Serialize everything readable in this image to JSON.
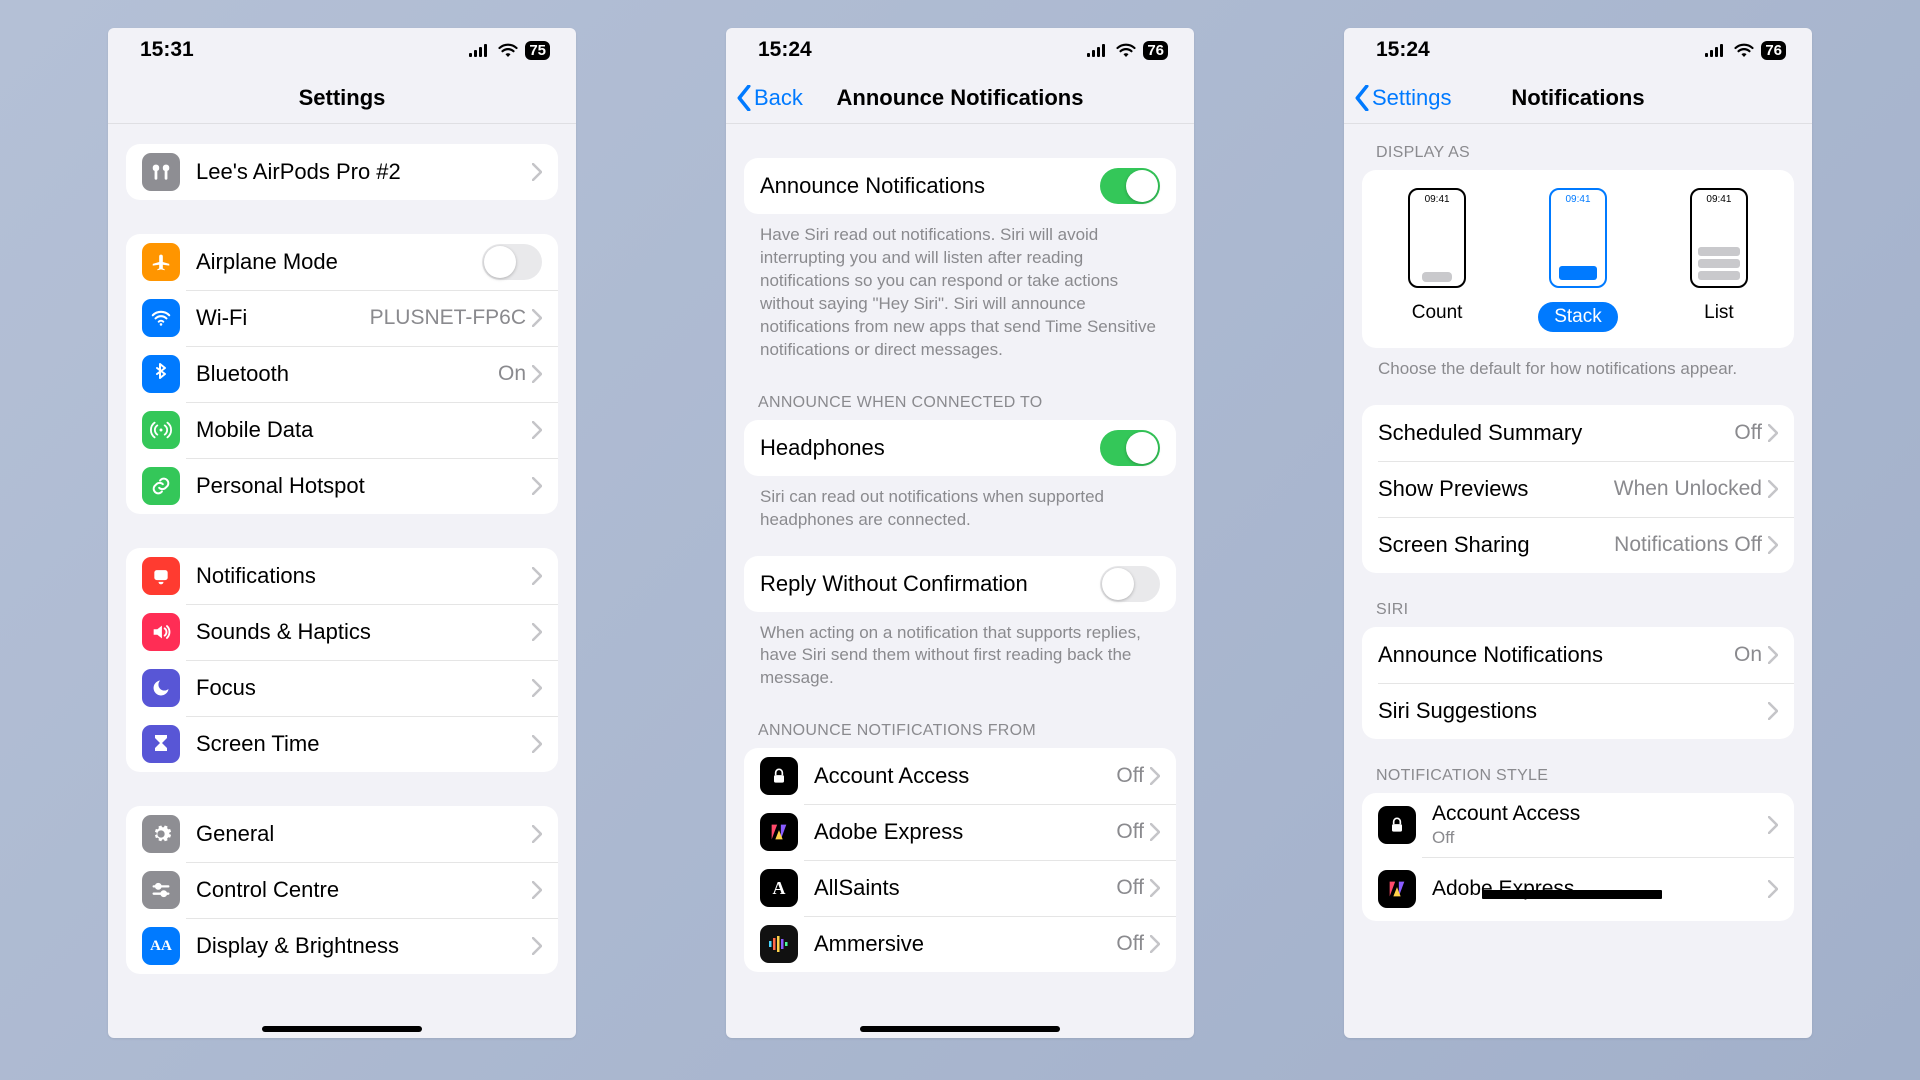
{
  "phone1": {
    "status": {
      "time": "15:31",
      "battery": "75"
    },
    "title": "Settings",
    "airpods": {
      "label": "Lee's AirPods Pro #2"
    },
    "group_connectivity": [
      {
        "key": "airplane",
        "label": "Airplane Mode",
        "type": "toggle",
        "on": false,
        "color": "#ff9500",
        "icon": "airplane-icon"
      },
      {
        "key": "wifi",
        "label": "Wi-Fi",
        "value": "PLUSNET-FP6C",
        "color": "#007aff",
        "icon": "wifi-icon"
      },
      {
        "key": "bluetooth",
        "label": "Bluetooth",
        "value": "On",
        "color": "#007aff",
        "icon": "bluetooth-icon"
      },
      {
        "key": "mobiledata",
        "label": "Mobile Data",
        "value": "",
        "color": "#34c759",
        "icon": "antenna-icon"
      },
      {
        "key": "hotspot",
        "label": "Personal Hotspot",
        "value": "",
        "color": "#34c759",
        "icon": "link-icon"
      }
    ],
    "group_sounds": [
      {
        "key": "notifications",
        "label": "Notifications",
        "color": "#ff3b30",
        "icon": "bell-icon"
      },
      {
        "key": "sounds",
        "label": "Sounds & Haptics",
        "color": "#ff2d55",
        "icon": "speaker-icon"
      },
      {
        "key": "focus",
        "label": "Focus",
        "color": "#5856d6",
        "icon": "moon-icon"
      },
      {
        "key": "screentime",
        "label": "Screen Time",
        "color": "#5856d6",
        "icon": "hourglass-icon"
      }
    ],
    "group_general": [
      {
        "key": "general",
        "label": "General",
        "color": "#8e8e93",
        "icon": "gear-icon"
      },
      {
        "key": "control",
        "label": "Control Centre",
        "color": "#8e8e93",
        "icon": "sliders-icon"
      },
      {
        "key": "display",
        "label": "Display & Brightness",
        "color": "#007aff",
        "icon": "text-size-icon",
        "text_glyph": "AA"
      }
    ]
  },
  "phone2": {
    "status": {
      "time": "15:24",
      "battery": "76"
    },
    "back": "Back",
    "title": "Announce Notifications",
    "rows": {
      "announce": {
        "label": "Announce Notifications",
        "on": true
      },
      "announce_footer": "Have Siri read out notifications. Siri will avoid interrupting you and will listen after reading notifications so you can respond or take actions without saying \"Hey Siri\". Siri will announce notifications from new apps that send Time Sensitive notifications or direct messages.",
      "header_connected": "ANNOUNCE WHEN CONNECTED TO",
      "headphones": {
        "label": "Headphones",
        "on": true
      },
      "headphones_footer": "Siri can read out notifications when supported headphones are connected.",
      "reply": {
        "label": "Reply Without Confirmation",
        "on": false
      },
      "reply_footer": "When acting on a notification that supports replies, have Siri send them without first reading back the message.",
      "header_from": "ANNOUNCE NOTIFICATIONS FROM"
    },
    "apps": [
      {
        "key": "account",
        "label": "Account Access",
        "value": "Off",
        "bg": "#000",
        "glyph": "lock"
      },
      {
        "key": "adobe",
        "label": "Adobe Express",
        "value": "Off",
        "bg": "#000",
        "glyph": "adobe"
      },
      {
        "key": "allsaints",
        "label": "AllSaints",
        "value": "Off",
        "bg": "#000",
        "glyph": "A"
      },
      {
        "key": "ammersive",
        "label": "Ammersive",
        "value": "Off",
        "bg": "#111",
        "glyph": "eq"
      }
    ]
  },
  "phone3": {
    "status": {
      "time": "15:24",
      "battery": "76"
    },
    "back": "Settings",
    "title": "Notifications",
    "display_header": "DISPLAY AS",
    "display_opts": {
      "count": "Count",
      "stack": "Stack",
      "list": "List",
      "mini_time": "09:41",
      "selected": "stack"
    },
    "display_footer": "Choose the default for how notifications appear.",
    "group_main": [
      {
        "key": "summary",
        "label": "Scheduled Summary",
        "value": "Off"
      },
      {
        "key": "previews",
        "label": "Show Previews",
        "value": "When Unlocked"
      },
      {
        "key": "screenshare",
        "label": "Screen Sharing",
        "value": "Notifications Off"
      }
    ],
    "siri_header": "SIRI",
    "group_siri": [
      {
        "key": "announce",
        "label": "Announce Notifications",
        "value": "On"
      },
      {
        "key": "suggest",
        "label": "Siri Suggestions",
        "value": ""
      }
    ],
    "style_header": "NOTIFICATION STYLE",
    "apps": [
      {
        "key": "account",
        "label": "Account Access",
        "sub": "Off",
        "bg": "#000",
        "glyph": "lock"
      },
      {
        "key": "adobe",
        "label": "Adobe Express",
        "sub": "",
        "bg": "#000",
        "glyph": "adobe"
      }
    ]
  }
}
